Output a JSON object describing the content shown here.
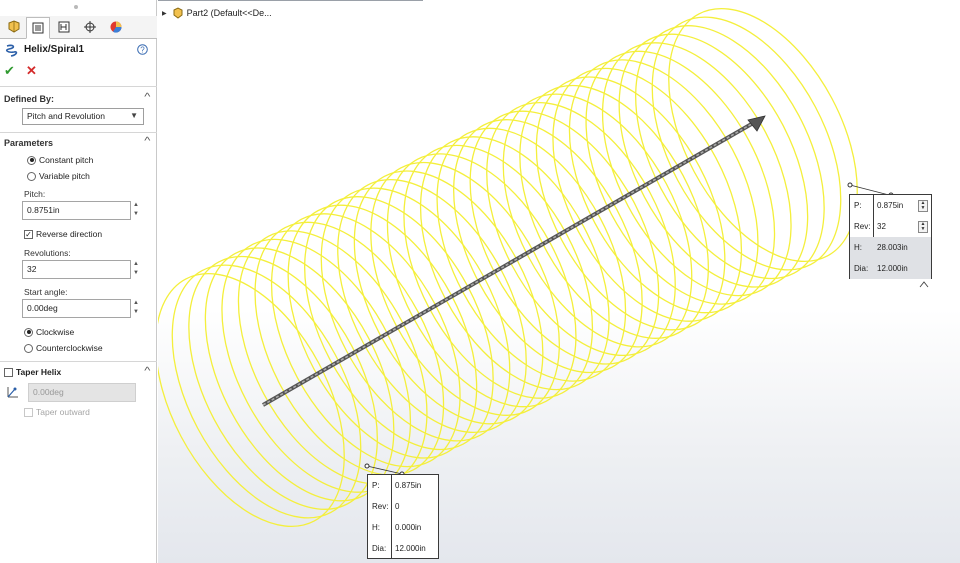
{
  "property_manager": {
    "feature_title": "Helix/Spiral1",
    "defined_by": {
      "heading": "Defined By:",
      "selected": "Pitch and Revolution"
    },
    "parameters": {
      "heading": "Parameters",
      "constant_pitch_label": "Constant pitch",
      "variable_pitch_label": "Variable pitch",
      "pitch_label": "Pitch:",
      "pitch_value": "0.8751in",
      "reverse_direction_label": "Reverse direction",
      "revolutions_label": "Revolutions:",
      "revolutions_value": "32",
      "start_angle_label": "Start angle:",
      "start_angle_value": "0.00deg",
      "clockwise_label": "Clockwise",
      "counterclockwise_label": "Counterclockwise"
    },
    "taper_helix": {
      "heading": "Taper Helix",
      "angle_value": "0.00deg",
      "taper_outward_label": "Taper outward"
    }
  },
  "viewport": {
    "tree_root": "Part2  (Default<<De...",
    "callout_end": {
      "p_label": "P:",
      "p_value": "0.875in",
      "rev_label": "Rev:",
      "rev_value": "32",
      "h_label": "H:",
      "h_value": "28.003in",
      "dia_label": "Dia:",
      "dia_value": "12.000in"
    },
    "callout_start": {
      "p_label": "P:",
      "p_value": "0.875in",
      "rev_label": "Rev:",
      "rev_value": "0",
      "h_label": "H:",
      "h_value": "0.000in",
      "dia_label": "Dia:",
      "dia_value": "12.000in"
    }
  },
  "colors": {
    "helix": "#f4ef3c",
    "ok_check": "#2f9a2f",
    "cancel_x": "#d42b2b"
  },
  "icons": [
    "feature-manager-icon",
    "property-manager-icon",
    "configuration-manager-icon",
    "dimxpert-icon",
    "display-manager-icon",
    "helix-icon",
    "help-icon",
    "ok-check-icon",
    "cancel-x-icon",
    "taper-angle-icon",
    "part-icon"
  ]
}
